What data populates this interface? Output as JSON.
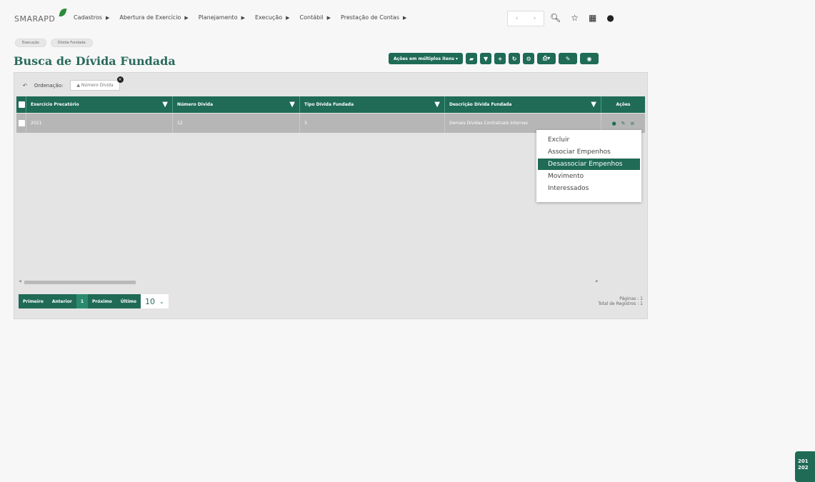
{
  "app": {
    "logo": "SMARAPD"
  },
  "menu": [
    {
      "label": "Cadastros"
    },
    {
      "label": "Abertura de Exercício"
    },
    {
      "label": "Planejamento"
    },
    {
      "label": "Execução"
    },
    {
      "label": "Contábil"
    },
    {
      "label": "Prestação de Contas"
    }
  ],
  "breadcrumb": [
    "Execução",
    "Dívida Fundada"
  ],
  "page": {
    "title": "Busca de Dívida Fundada"
  },
  "toolbar": {
    "multi_label": "Ações em múltiplos itens ▾"
  },
  "sort": {
    "label": "Ordenação:",
    "chip": "▲ Número Dívida"
  },
  "table": {
    "columns": [
      "Exercício Precatório",
      "Número Dívida",
      "Tipo Dívida Fundada",
      "Descrição Dívida Fundada",
      "Ações"
    ],
    "rows": [
      {
        "exercicio": "2021",
        "numero": "12",
        "tipo": "3",
        "descricao": "Demais Dívidas Contratuais Internas"
      }
    ]
  },
  "context_menu": [
    "Excluir",
    "Associar Empenhos",
    "Desassociar Empenhos",
    "Movimento",
    "Interessados"
  ],
  "pager": {
    "first": "Primeiro",
    "prev": "Anterior",
    "current": "1",
    "next": "Próximo",
    "last": "Último",
    "page_size": "10"
  },
  "info": {
    "pages": "Páginas : 1",
    "total": "Total de Registros : 1"
  },
  "year_badge": {
    "line1": "201",
    "line2": "202"
  },
  "colors": {
    "accent": "#1f6b55",
    "row": "#b6b6b6"
  }
}
